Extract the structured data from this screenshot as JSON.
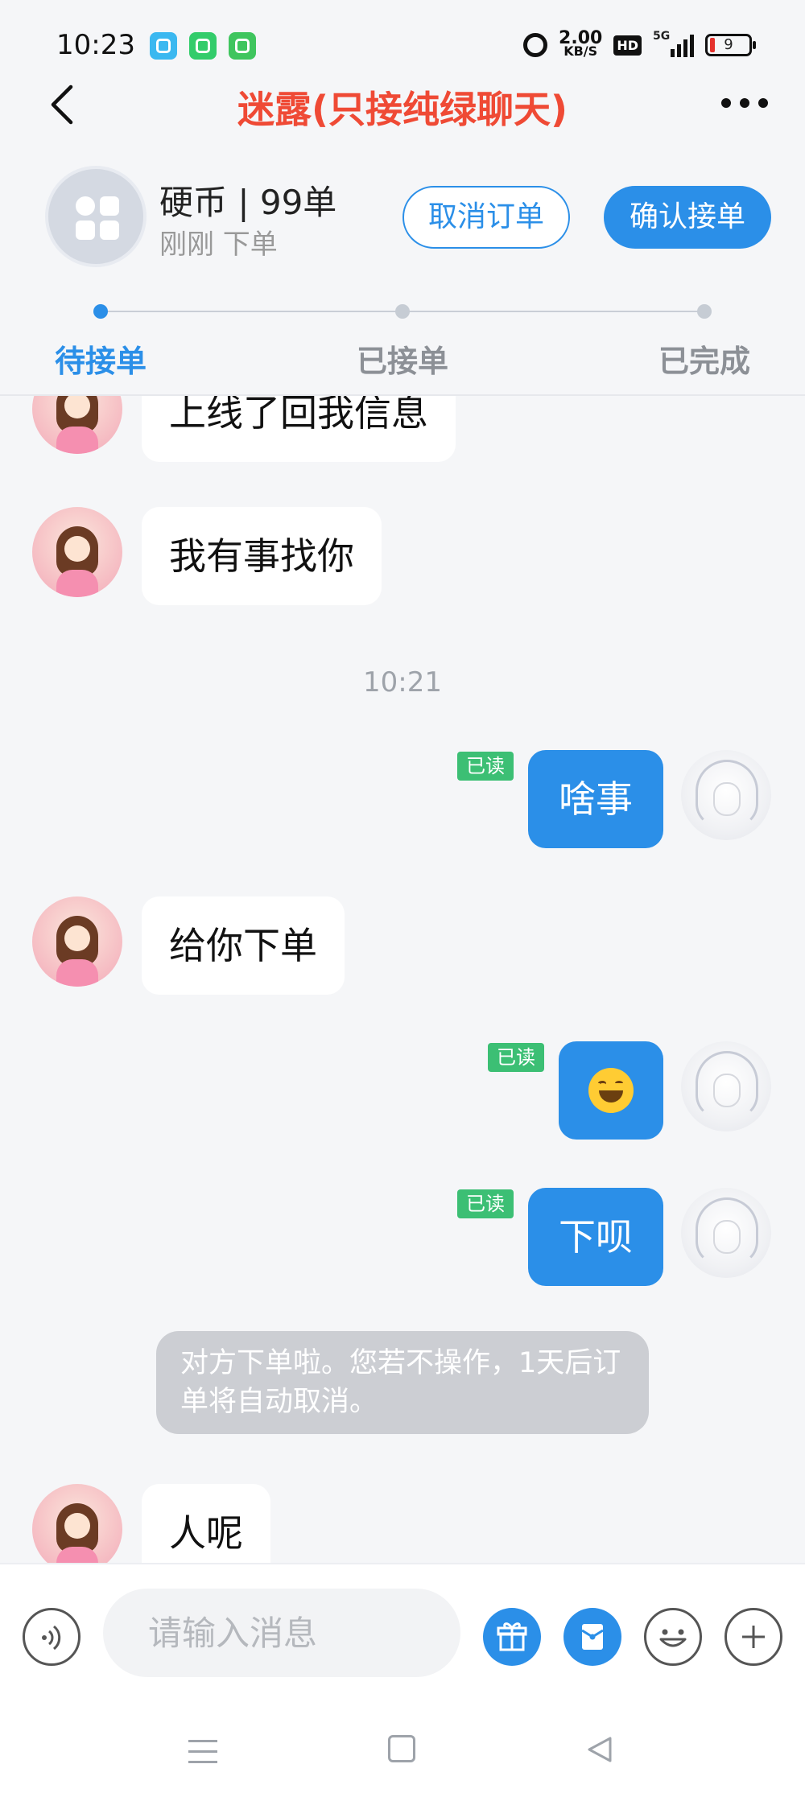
{
  "status_bar": {
    "time": "10:23",
    "speed_value": "2.00",
    "speed_unit": "KB/S",
    "hd_label": "HD",
    "network": "5G",
    "battery": "9"
  },
  "nav": {
    "title": "迷露(只接纯绿聊天)"
  },
  "order": {
    "title": "硬币 | 99单",
    "subtitle": "刚刚 下单",
    "cancel_label": "取消订单",
    "confirm_label": "确认接单"
  },
  "progress": {
    "steps": [
      "待接单",
      "已接单",
      "已完成"
    ],
    "current": 0
  },
  "chat": {
    "messages": [
      {
        "side": "left",
        "text": "上线了回我信息"
      },
      {
        "side": "left",
        "text": "我有事找你"
      },
      {
        "type": "time",
        "text": "10:21"
      },
      {
        "side": "right",
        "text": "啥事",
        "status": "已读"
      },
      {
        "side": "left",
        "text": "给你下单"
      },
      {
        "side": "right",
        "text": "",
        "emoji": "grinning-face",
        "status": "已读"
      },
      {
        "side": "right",
        "text": "下呗",
        "status": "已读"
      },
      {
        "type": "system",
        "text": "对方下单啦。您若不操作，1天后订单将自动取消。"
      },
      {
        "side": "left",
        "text": "人呢"
      }
    ]
  },
  "input": {
    "placeholder": "请输入消息"
  },
  "colors": {
    "accent": "#2b8fe8",
    "title_red": "#ef4a35",
    "read_green": "#3cbf74"
  }
}
